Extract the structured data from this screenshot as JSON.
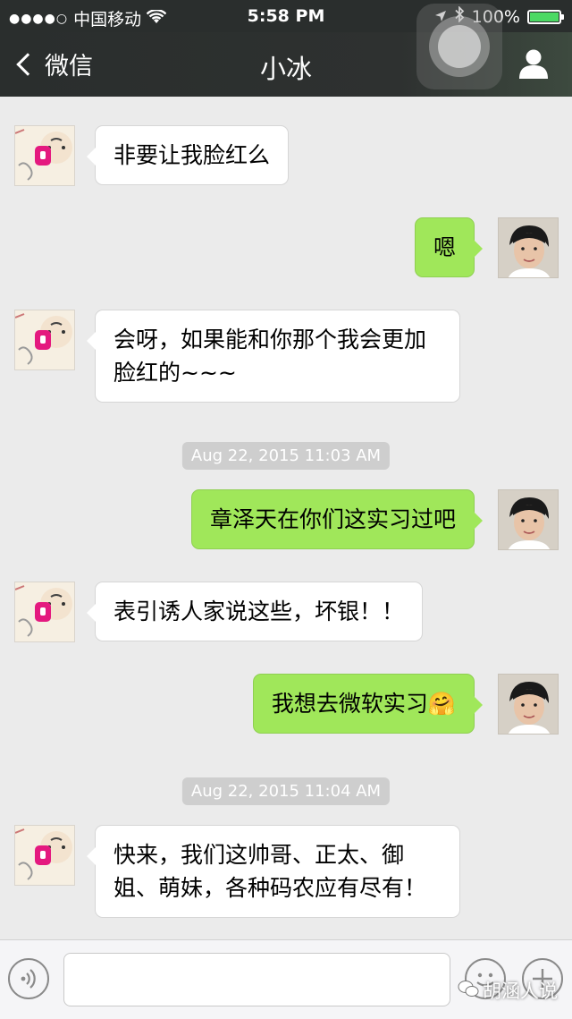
{
  "status_bar": {
    "signal_dots": "●●●●○",
    "carrier": "中国移动",
    "wifi_icon": "wifi-icon",
    "time": "5:58 PM",
    "battery_percent": "100%",
    "battery_level": 1.0
  },
  "nav": {
    "back_label": "微信",
    "title": "小冰"
  },
  "messages": [
    {
      "side": "left",
      "sender": "小冰",
      "text": "非要让我脸红么"
    },
    {
      "side": "right",
      "sender": "me",
      "text": "嗯"
    },
    {
      "side": "left",
      "sender": "小冰",
      "text": "会呀，如果能和你那个我会更加脸红的~~~"
    },
    {
      "type": "timestamp",
      "text": "Aug 22, 2015 11:03 AM"
    },
    {
      "side": "right",
      "sender": "me",
      "text": "章泽天在你们这实习过吧"
    },
    {
      "side": "left",
      "sender": "小冰",
      "text": "表引诱人家说这些，坏银！！"
    },
    {
      "side": "right",
      "sender": "me",
      "text": "我想去微软实习",
      "emoji": "🤗"
    },
    {
      "type": "timestamp",
      "text": "Aug 22, 2015 11:04 AM"
    },
    {
      "side": "left",
      "sender": "小冰",
      "text": "快来，我们这帅哥、正太、御姐、萌妹，各种码农应有尽有！"
    }
  ],
  "input": {
    "value": "",
    "placeholder": ""
  },
  "watermark": "胡涵人说",
  "colors": {
    "outgoing_bubble": "#a0e75a",
    "incoming_bubble": "#ffffff",
    "nav_background": "#2e3130",
    "chat_background": "#ebebeb"
  }
}
